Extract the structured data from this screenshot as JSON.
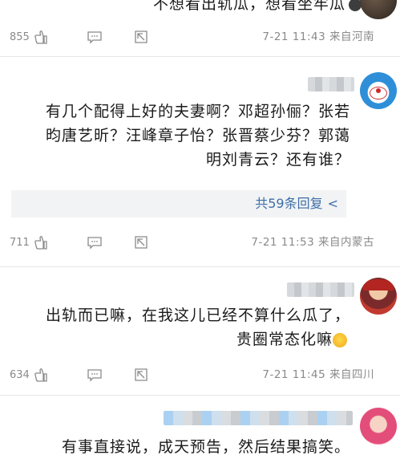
{
  "comments": [
    {
      "text_lines": [
        "不想看出轨瓜，想看坐牢瓜"
      ],
      "likes": "855",
      "meta": "7-21 11:43 来自河南"
    },
    {
      "text_lines": [
        "有几个配得上好的夫妻啊？邓超孙俪？张若",
        "昀唐艺昕？汪峰章子怡？张晋蔡少芬？郭蔼",
        "明刘青云？还有谁？"
      ],
      "likes": "711",
      "meta": "7-21 11:53 来自内蒙古",
      "replies_label": "共59条回复"
    },
    {
      "text_lines": [
        "出轨而已嘛，在我这儿已经不算什么瓜了，",
        "贵圈常态化嘛"
      ],
      "likes": "634",
      "meta": "7-21 11:45 来自四川"
    },
    {
      "text_lines": [
        "有事直接说，成天预告，然后结果搞笑。"
      ]
    }
  ],
  "icons": {
    "like": "thumbs-up-icon",
    "reply": "comment-icon",
    "share": "share-icon",
    "reply_chevron": "chevron-icon"
  },
  "colors": {
    "link_blue": "#3e6fa8",
    "meta_gray": "#8a8a8a",
    "reply_bg": "#f2f3f5",
    "divider": "#e6e6e6"
  }
}
